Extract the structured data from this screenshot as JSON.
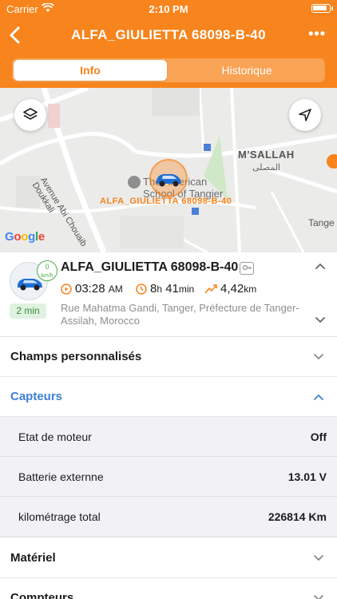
{
  "status_bar": {
    "carrier": "Carrier",
    "time": "2:10 PM"
  },
  "navbar": {
    "title": "ALFA_GIULIETTA 68098-B-40",
    "more_label": "•••"
  },
  "tabs": [
    {
      "label": "Info",
      "active": true
    },
    {
      "label": "Historique",
      "active": false
    }
  ],
  "map": {
    "area_label": "M'SALLAH",
    "area_label_ar": "المصلى",
    "street": "Avenue Abi Chouaib Doukkali",
    "school": "The American School of Tangier",
    "car_label": "ALFA_GIULIETTA 68098-B-40",
    "city_fragment": "Tange",
    "google": "Google"
  },
  "vehicle": {
    "name": "ALFA_GIULIETTA 68098-B-40",
    "speed_value": "0",
    "speed_unit": "km/h",
    "last_update": "2 min",
    "time": "03:28",
    "time_suffix": "AM",
    "duration_h": "8",
    "duration_h_unit": "h",
    "duration_m": "41",
    "duration_m_unit": "min",
    "distance": "4,42",
    "distance_unit": "km",
    "address": "Rue Mahatma Gandi, Tanger, Préfecture de Tanger-Assilah, Morocco"
  },
  "sections": {
    "custom_fields": "Champs personnalisés",
    "sensors": "Capteurs",
    "hardware": "Matériel",
    "counters": "Compteurs"
  },
  "sensors": [
    {
      "label": "Etat de moteur",
      "value": "Off"
    },
    {
      "label": "Batterie externne",
      "value": "13.01 V"
    },
    {
      "label": "kilométrage total",
      "value": "226814 Km"
    }
  ],
  "colors": {
    "accent": "#f7841c",
    "link_blue": "#3d7fd6",
    "online_green": "#4cae4c"
  }
}
